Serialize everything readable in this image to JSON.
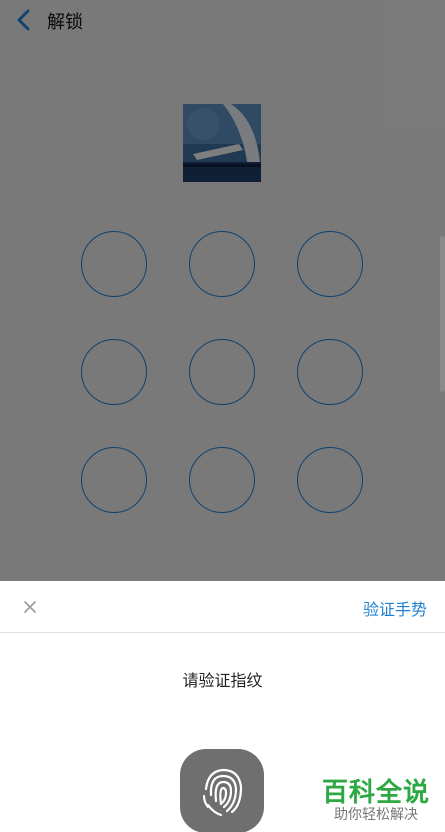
{
  "header": {
    "back_icon": "chevron-left-icon",
    "title": "解锁"
  },
  "lock_pattern": {
    "dots": 9,
    "dot_color": "#1f7fd4"
  },
  "sheet": {
    "close_icon": "close-icon",
    "verify_gesture_label": "验证手势",
    "prompt": "请验证指纹",
    "fingerprint_icon": "fingerprint-icon"
  },
  "watermark": {
    "main": "百科全说",
    "sub": "助你轻松解决"
  },
  "colors": {
    "accent": "#1f7fd4",
    "watermark_green": "#2ea843"
  }
}
